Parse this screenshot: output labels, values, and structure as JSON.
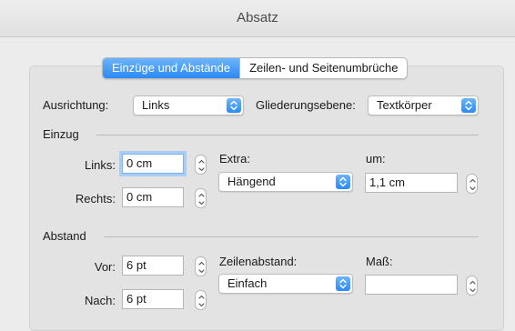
{
  "window": {
    "title": "Absatz"
  },
  "tabs": [
    {
      "label": "Einzüge und Abstände",
      "active": true
    },
    {
      "label": "Zeilen- und Seitenumbrüche",
      "active": false
    }
  ],
  "general": {
    "alignment_label": "Ausrichtung:",
    "alignment_value": "Links",
    "outline_label": "Gliederungsebene:",
    "outline_value": "Textkörper"
  },
  "indent": {
    "section_label": "Einzug",
    "left_label": "Links:",
    "left_value": "0 cm",
    "right_label": "Rechts:",
    "right_value": "0 cm",
    "special_label": "Extra:",
    "special_value": "Hängend",
    "by_label": "um:",
    "by_value": "1,1 cm"
  },
  "spacing": {
    "section_label": "Abstand",
    "before_label": "Vor:",
    "before_value": "6 pt",
    "after_label": "Nach:",
    "after_value": "6 pt",
    "line_spacing_label": "Zeilenabstand:",
    "line_spacing_value": "Einfach",
    "at_label": "Maß:",
    "at_value": ""
  },
  "colors": {
    "accent": "#2b8af5",
    "focus_ring": "#a9cdf7"
  },
  "icons": {
    "select_arrow": "updown-chevron-icon",
    "stepper": "stepper-arrows-icon"
  }
}
